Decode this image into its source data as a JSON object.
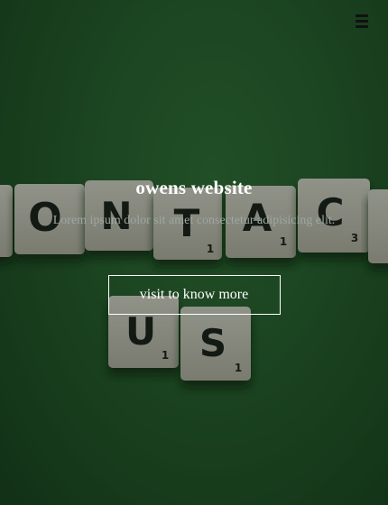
{
  "header": {
    "menu_icon": "hamburger-menu-icon"
  },
  "hero": {
    "title": "owens website",
    "tagline": "Lorem ipsum dolor sit amet consectetur adipisicing elit.",
    "cta_label": "visit to know more"
  },
  "background": {
    "tiles_row1": [
      "O",
      "N",
      "T",
      "A",
      "C"
    ],
    "tiles_row2": [
      "U",
      "S"
    ]
  },
  "colors": {
    "background_green": "#2f6a36",
    "text": "#ffffff",
    "tagline": "#9da8a0"
  }
}
